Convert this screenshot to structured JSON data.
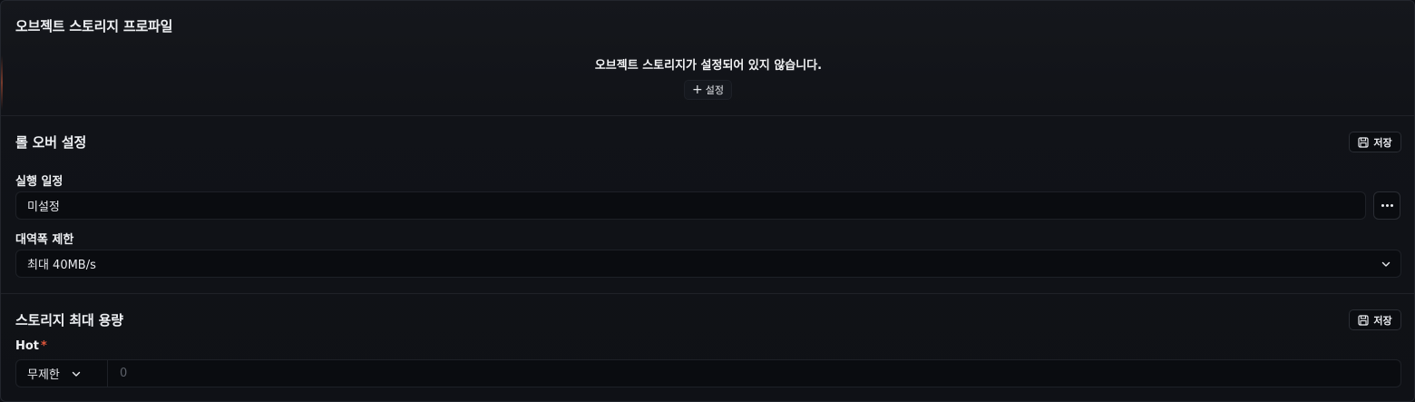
{
  "object_storage": {
    "title": "오브젝트 스토리지 프로파일",
    "empty_message": "오브젝트 스토리지가 설정되어 있지 않습니다.",
    "setup_label": "설정",
    "setup_icon": "plus-icon"
  },
  "rollover": {
    "title": "롤 오버 설정",
    "save_label": "저장",
    "schedule_label": "실행 일정",
    "schedule_value": "미설정",
    "bandwidth_label": "대역폭 제한",
    "bandwidth_value": "최대 40MB/s"
  },
  "storage_capacity": {
    "title": "스토리지 최대 용량",
    "save_label": "저장",
    "hot_label": "Hot",
    "required_mark": "*",
    "unit_value": "무제한",
    "capacity_placeholder": "0"
  },
  "colors": {
    "background": "#0d0f14",
    "required": "#e0563b",
    "accent_glow": "#c85a3c"
  }
}
